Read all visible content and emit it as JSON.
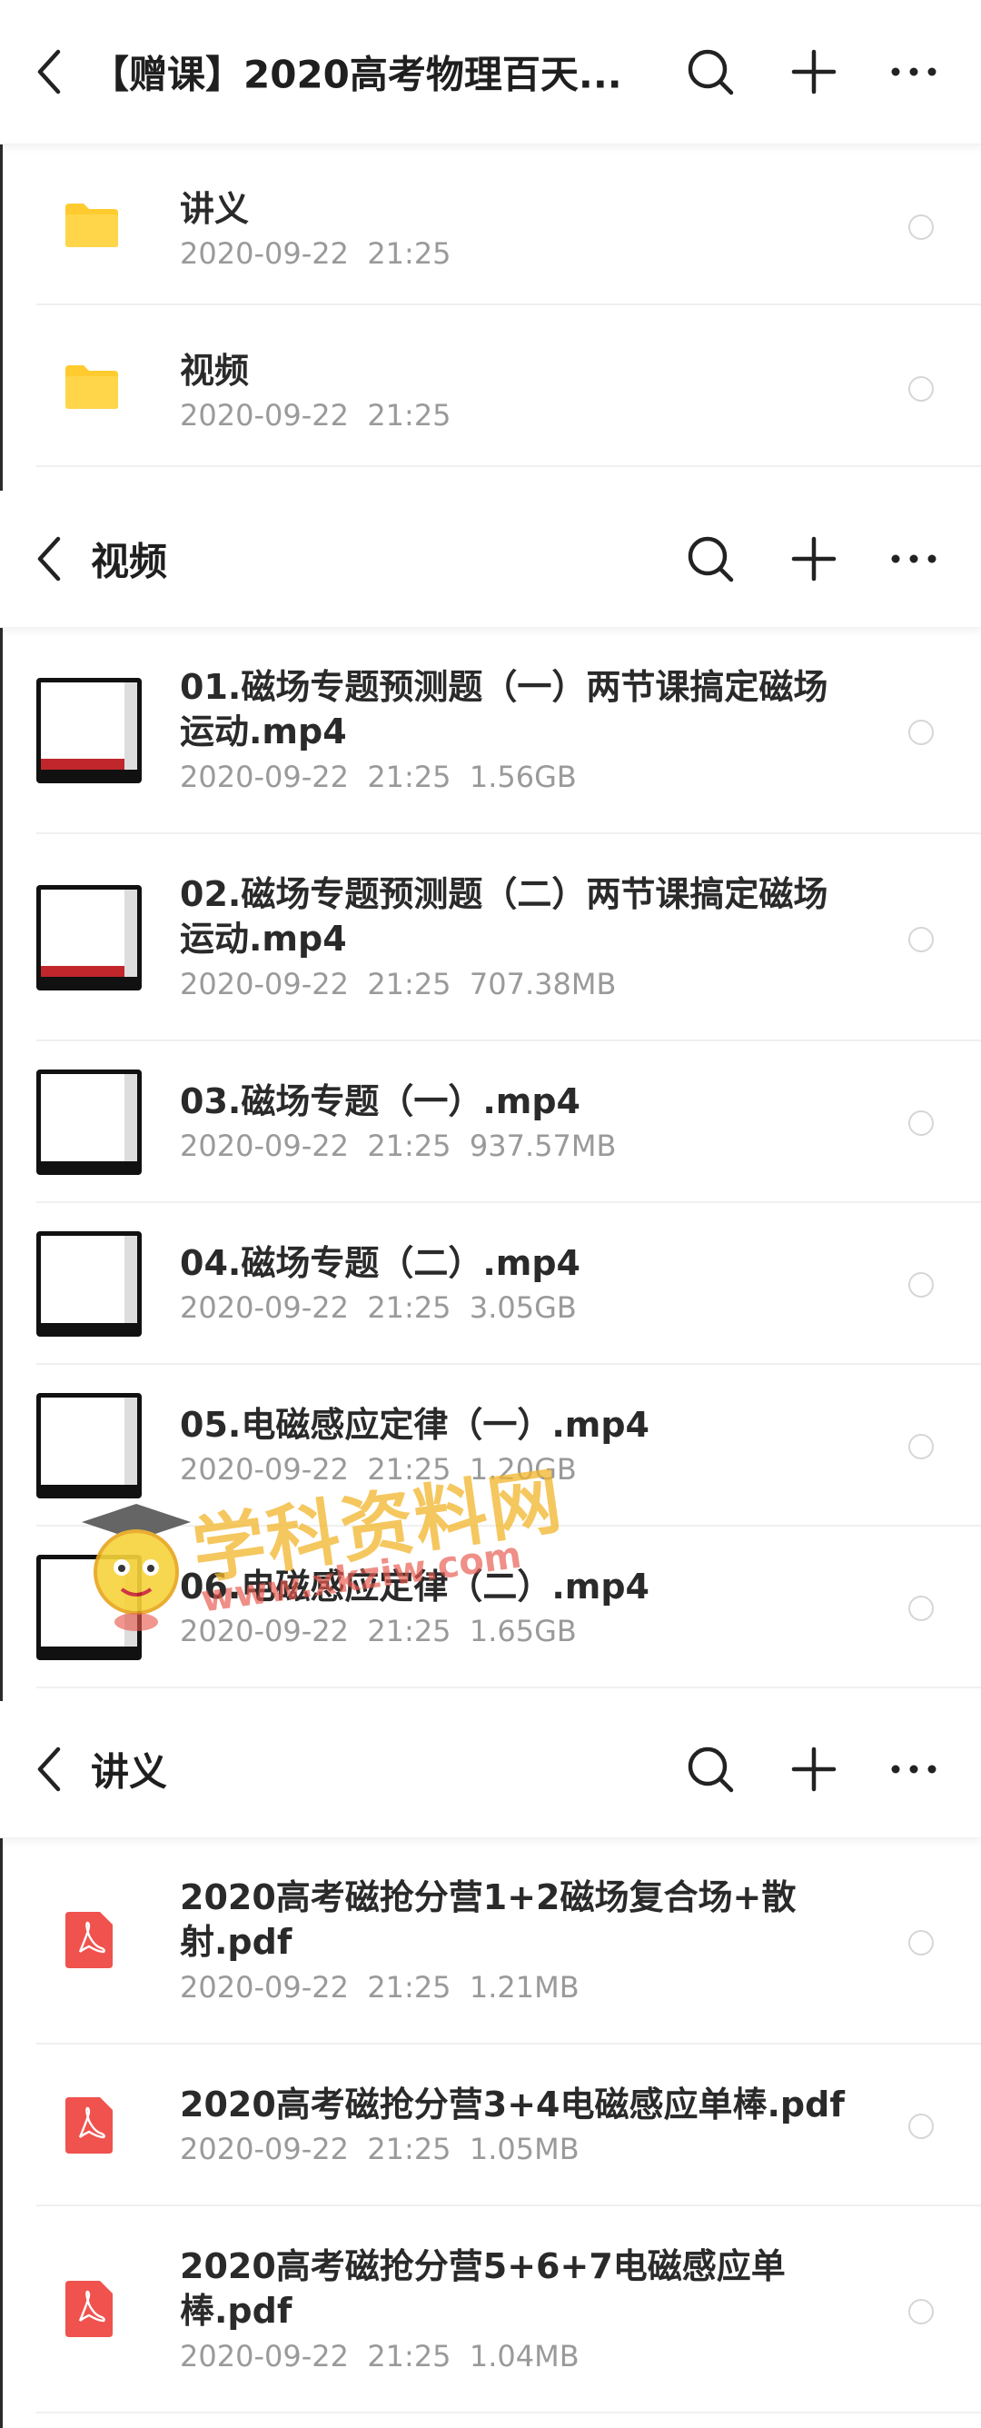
{
  "panels": [
    {
      "title": "【赠课】2020高考物理百天...",
      "rows": [
        {
          "kind": "folder",
          "name": "讲义",
          "date": "2020-09-22  21:25",
          "size": ""
        },
        {
          "kind": "folder",
          "name": "视频",
          "date": "2020-09-22  21:25",
          "size": ""
        }
      ]
    },
    {
      "title": "视频",
      "rows": [
        {
          "kind": "video",
          "name": "01.磁场专题预测题（一）两节课搞定磁场运动.mp4",
          "date": "2020-09-22  21:25",
          "size": "1.56GB"
        },
        {
          "kind": "video",
          "name": "02.磁场专题预测题（二）两节课搞定磁场运动.mp4",
          "date": "2020-09-22  21:25",
          "size": "707.38MB"
        },
        {
          "kind": "video",
          "name": "03.磁场专题（一）.mp4",
          "date": "2020-09-22  21:25",
          "size": "937.57MB"
        },
        {
          "kind": "video",
          "name": "04.磁场专题（二）.mp4",
          "date": "2020-09-22  21:25",
          "size": "3.05GB"
        },
        {
          "kind": "video",
          "name": "05.电磁感应定律（一）.mp4",
          "date": "2020-09-22  21:25",
          "size": "1.20GB"
        },
        {
          "kind": "video",
          "name": "06.电磁感应定律（二）.mp4",
          "date": "2020-09-22  21:25",
          "size": "1.65GB"
        }
      ]
    },
    {
      "title": "讲义",
      "rows": [
        {
          "kind": "pdf",
          "name": "2020高考磁抢分营1+2磁场复合场+散射.pdf",
          "date": "2020-09-22  21:25",
          "size": "1.21MB"
        },
        {
          "kind": "pdf",
          "name": "2020高考磁抢分营3+4电磁感应单棒.pdf",
          "date": "2020-09-22  21:25",
          "size": "1.05MB"
        },
        {
          "kind": "pdf",
          "name": "2020高考磁抢分营5+6+7电磁感应单棒.pdf",
          "date": "2020-09-22  21:25",
          "size": "1.04MB"
        }
      ]
    }
  ],
  "icons": {
    "back": "chevron-left-icon",
    "search": "search-icon",
    "add": "plus-icon",
    "more": "more-icon",
    "folder": "folder-icon",
    "pdf": "pdf-icon",
    "video": "video-thumbnail",
    "select": "radio-circle"
  },
  "colors": {
    "folder": "#FFCB2E",
    "pdf": "#F0524E",
    "radio": "#D6D6D6",
    "meta": "#9A9A9A"
  },
  "watermark": {
    "text": "学科资料网",
    "url": "www.xkziw.com"
  }
}
